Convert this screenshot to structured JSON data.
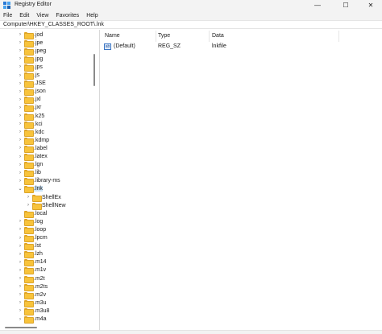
{
  "window": {
    "title": "Registry Editor",
    "controls": {
      "minimize": "—",
      "maximize": "☐",
      "close": "✕"
    },
    "icon": "registry-editor-icon"
  },
  "menu": [
    "File",
    "Edit",
    "View",
    "Favorites",
    "Help"
  ],
  "address": "Computer\\HKEY_CLASSES_ROOT\\.lnk",
  "tree": [
    {
      "label": ".jod",
      "expanded": false
    },
    {
      "label": ".jpe",
      "expanded": false
    },
    {
      "label": ".jpeg",
      "expanded": false
    },
    {
      "label": ".jpg",
      "expanded": false
    },
    {
      "label": ".jps",
      "expanded": false
    },
    {
      "label": ".js",
      "expanded": false
    },
    {
      "label": ".JSE",
      "expanded": false
    },
    {
      "label": ".json",
      "expanded": false
    },
    {
      "label": ".jxl",
      "expanded": false
    },
    {
      "label": ".jxr",
      "expanded": false
    },
    {
      "label": ".k25",
      "expanded": false
    },
    {
      "label": ".kci",
      "expanded": false
    },
    {
      "label": ".kdc",
      "expanded": false
    },
    {
      "label": ".kdmp",
      "expanded": false
    },
    {
      "label": ".label",
      "expanded": false
    },
    {
      "label": ".latex",
      "expanded": false
    },
    {
      "label": ".lgn",
      "expanded": false
    },
    {
      "label": ".lib",
      "expanded": false
    },
    {
      "label": ".library-ms",
      "expanded": false
    },
    {
      "label": ".lnk",
      "expanded": true,
      "selected": true
    },
    {
      "label": "ShellEx",
      "expanded": false,
      "child": true
    },
    {
      "label": "ShellNew",
      "expanded": false,
      "child": true
    },
    {
      "label": ".local",
      "expanded": false,
      "nochev": true
    },
    {
      "label": ".log",
      "expanded": false
    },
    {
      "label": ".loop",
      "expanded": false
    },
    {
      "label": ".lpcm",
      "expanded": false
    },
    {
      "label": ".lst",
      "expanded": false
    },
    {
      "label": ".lzh",
      "expanded": false
    },
    {
      "label": ".m14",
      "expanded": false
    },
    {
      "label": ".m1v",
      "expanded": false
    },
    {
      "label": ".m2t",
      "expanded": false
    },
    {
      "label": ".m2ts",
      "expanded": false
    },
    {
      "label": ".m2v",
      "expanded": false
    },
    {
      "label": ".m3u",
      "expanded": false
    },
    {
      "label": ".m3u8",
      "expanded": false
    },
    {
      "label": ".m4a",
      "expanded": false
    }
  ],
  "list": {
    "columns": [
      "Name",
      "Type",
      "Data"
    ],
    "rows": [
      {
        "name": "(Default)",
        "type": "REG_SZ",
        "data": "lnkfile",
        "icon": "ab"
      }
    ]
  },
  "colors": {
    "folder": "#f8c33b",
    "selection": "#cce4f7",
    "chrome": "#f3f3f3"
  }
}
